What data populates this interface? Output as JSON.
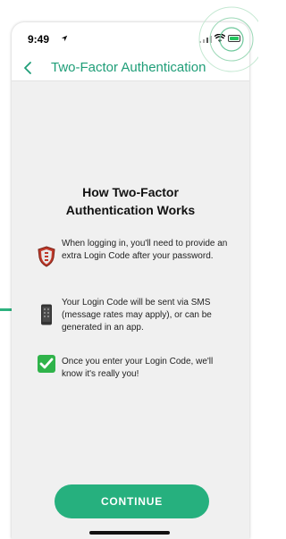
{
  "status_bar": {
    "time": "9:49"
  },
  "header": {
    "title": "Two-Factor Authentication"
  },
  "main": {
    "heading": "How Two-Factor\nAuthentication Works",
    "items": [
      {
        "icon": "shield-icon",
        "text": "When logging in, you'll need to provide an extra Login Code after your password."
      },
      {
        "icon": "phone-icon",
        "text": "Your Login Code will be sent via SMS (message rates may apply), or can be generated in an app."
      },
      {
        "icon": "check-icon",
        "text": "Once you enter your Login Code, we'll know it's really you!"
      }
    ],
    "continue_label": "CONTINUE"
  },
  "colors": {
    "accent": "#26b07e",
    "title": "#1f9e78",
    "background": "#f0f0f0"
  }
}
